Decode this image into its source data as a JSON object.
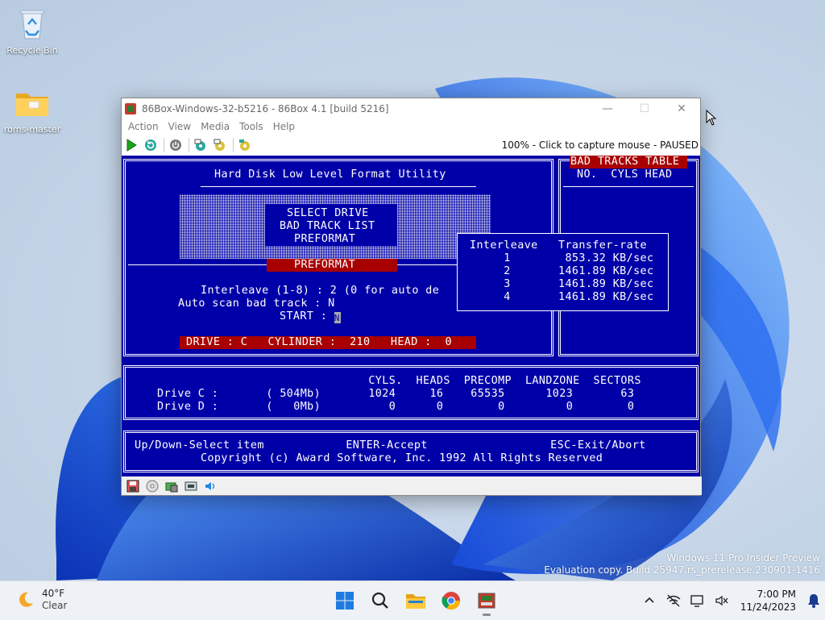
{
  "desktop": {
    "icons": [
      {
        "label": "Recycle Bin"
      },
      {
        "label": "roms-master"
      }
    ],
    "watermark": {
      "line1": "Windows 11 Pro Insider Preview",
      "line2": "Evaluation copy. Build 25947.rs_prerelease.230901-1416"
    }
  },
  "window": {
    "title": "86Box-Windows-32-b5216 - 86Box 4.1 [build 5216]",
    "menu": [
      "Action",
      "View",
      "Media",
      "Tools",
      "Help"
    ],
    "status_text": "100% - Click to capture mouse - PAUSED",
    "controls": {
      "minimize": "—",
      "maximize": "☐",
      "close": "✕"
    }
  },
  "bios": {
    "title": "Hard Disk Low Level Format Utility",
    "menu_items": [
      "SELECT DRIVE",
      "BAD TRACK LIST",
      "PREFORMAT"
    ],
    "selected_bar": "PREFORMAT",
    "interleave_line": "Interleave (1-8) : 2 (0 for auto de",
    "autoscan_line": "Auto scan bad track : N",
    "start_label": "START :",
    "start_value": "N",
    "drive_status": "DRIVE : C   CYLINDER :  210   HEAD :  0",
    "bad_tracks": {
      "title": "BAD TRACKS TABLE",
      "headers": "NO.  CYLS HEAD"
    },
    "interleave_popup": {
      "header": "Interleave   Transfer-rate",
      "rows": [
        "     1        853.32 KB/sec",
        "     2       1461.89 KB/sec",
        "     3       1461.89 KB/sec",
        "     4       1461.89 KB/sec"
      ]
    },
    "drive_table": {
      "header": "                               CYLS.  HEADS  PRECOMP  LANDZONE  SECTORS",
      "rows": [
        "Drive C :       ( 504Mb)       1024     16    65535      1023       63",
        "Drive D :       (   0Mb)          0      0        0         0        0"
      ]
    },
    "help": {
      "line1": "Up/Down-Select item            ENTER-Accept                  ESC-Exit/Abort",
      "line2": "Copyright (c) Award Software, Inc. 1992 All Rights Reserved"
    }
  },
  "taskbar": {
    "weather": {
      "temp": "40°F",
      "condition": "Clear"
    },
    "clock": {
      "time": "7:00 PM",
      "date": "11/24/2023"
    }
  },
  "colors": {
    "dos_blue": "#0000a8",
    "dos_red": "#a80000",
    "dos_white": "#ffffff"
  }
}
